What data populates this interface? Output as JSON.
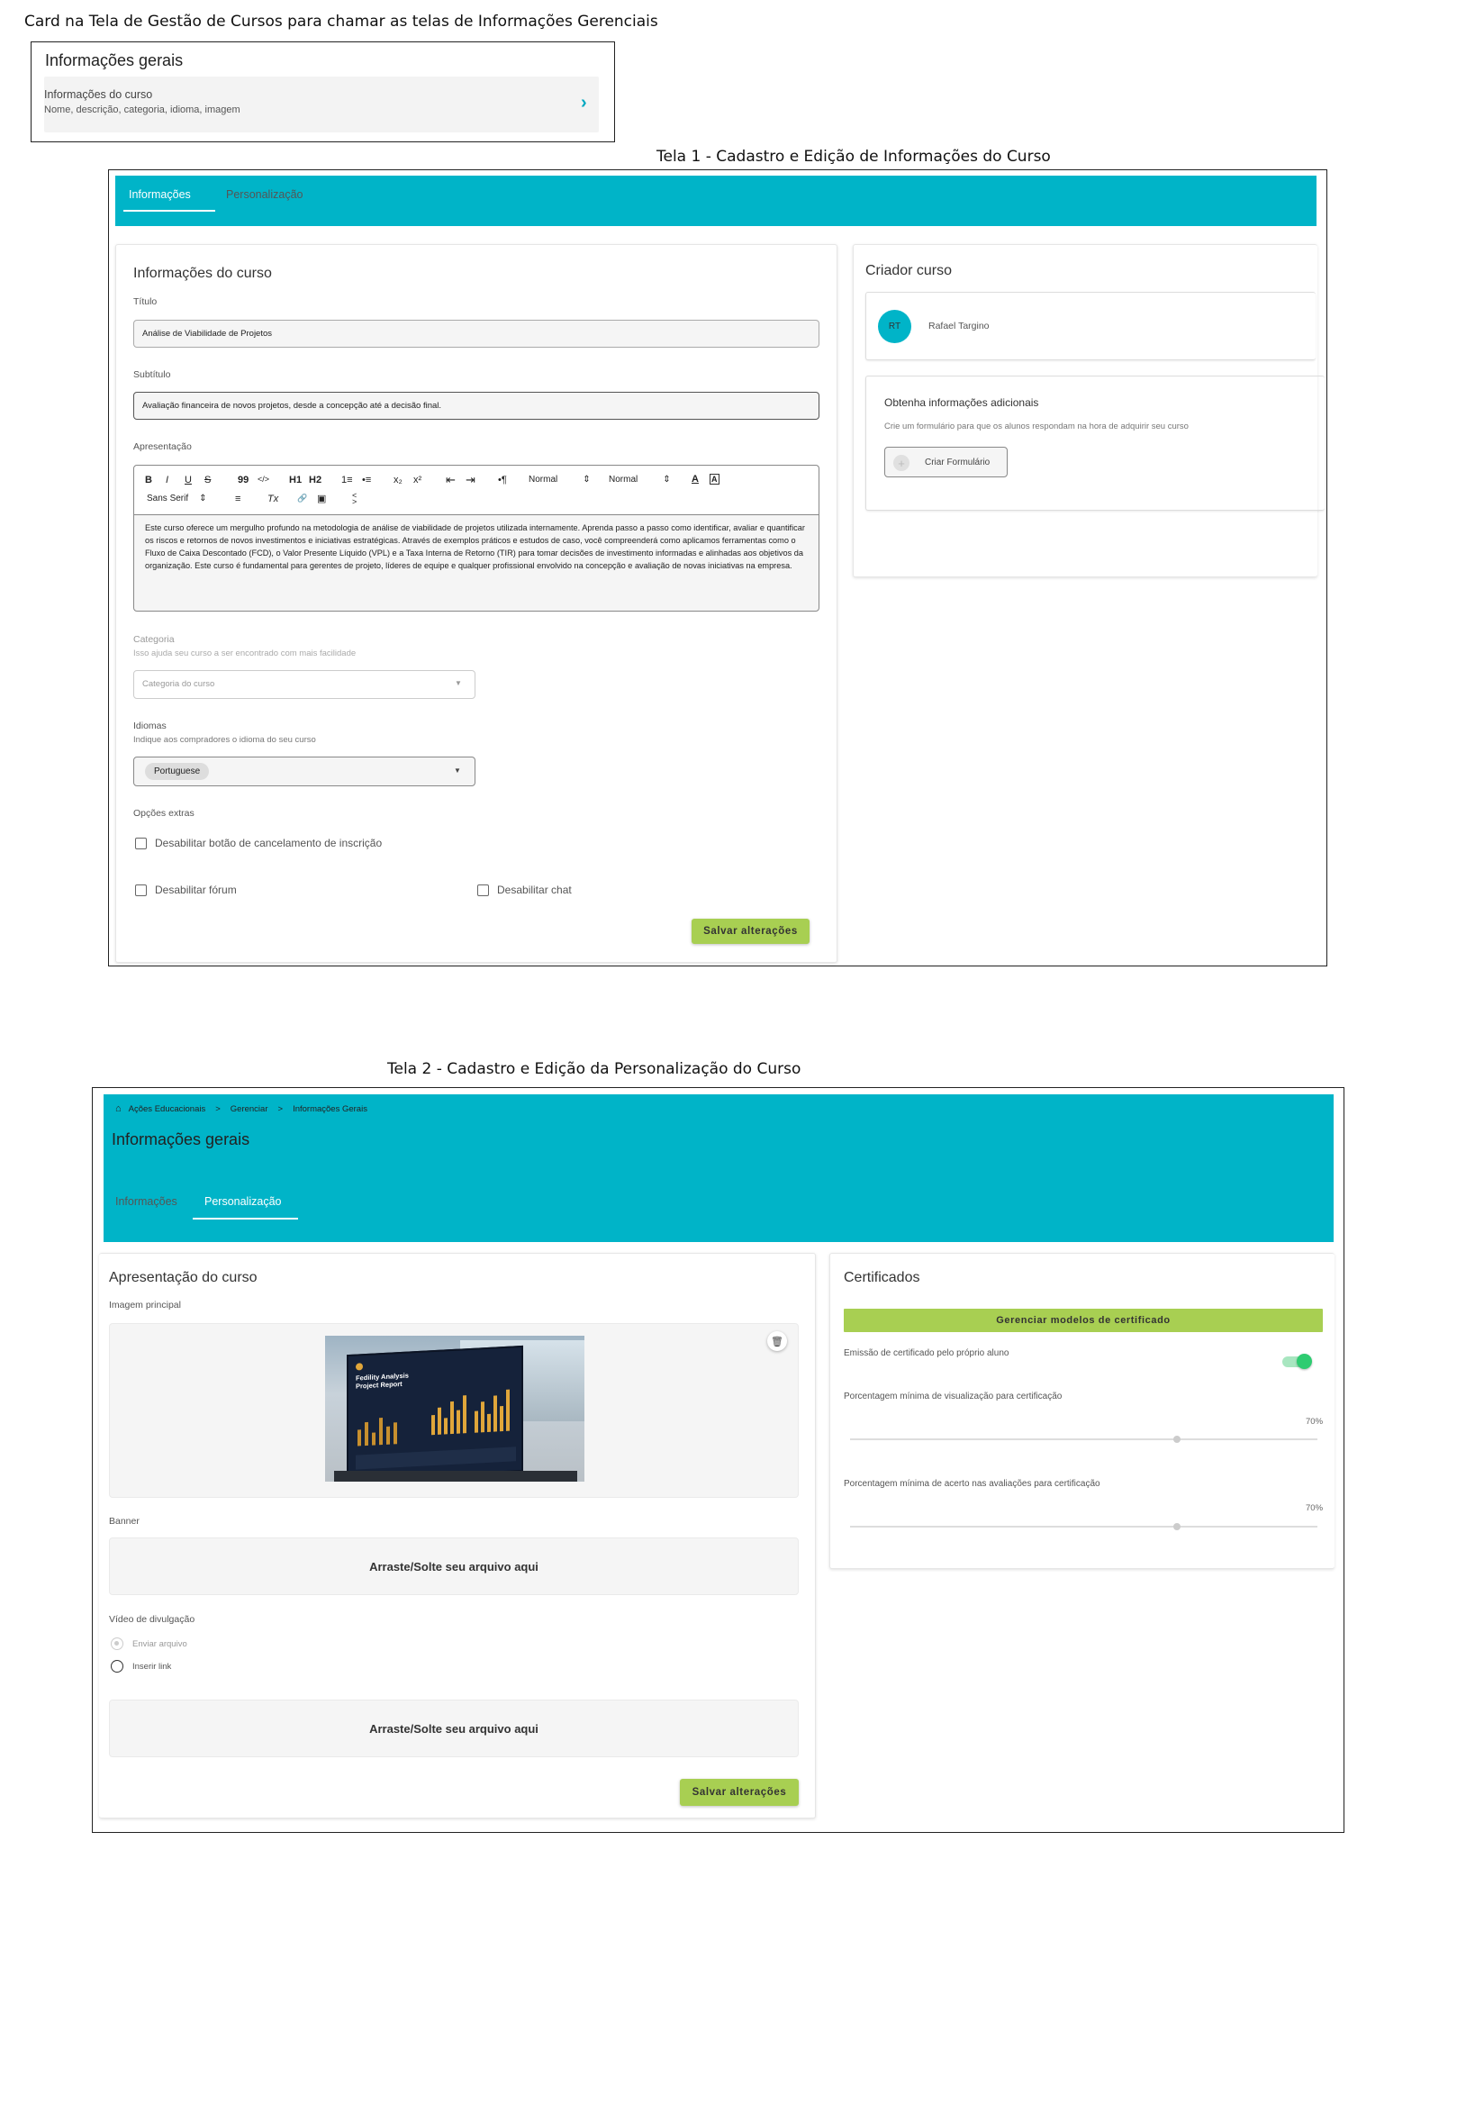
{
  "captions": {
    "card": "Card na Tela de Gestão de Cursos para chamar as telas de Informações Gerenciais",
    "tela1": "Tela 1 - Cadastro e Edição de Informações do Curso",
    "tela2": "Tela 2 - Cadastro e Edição da Personalização do Curso"
  },
  "card": {
    "title": "Informações gerais",
    "item_title": "Informações do curso",
    "item_desc": "Nome, descrição, categoria, idioma, imagem"
  },
  "tela1": {
    "tabs": [
      "Informações",
      "Personalização"
    ],
    "course_panel": {
      "title": "Informações do curso",
      "title_label": "Título",
      "title_value": "Análise de Viabilidade de Projetos",
      "subtitle_label": "Subtítulo",
      "subtitle_value": "Avaliação financeira de novos projetos, desde a concepção até a decisão final.",
      "presentation_label": "Apresentação",
      "toolbar": {
        "bold": "B",
        "italic": "I",
        "underline": "U",
        "strike": "S",
        "quote": "99",
        "code": "</>",
        "h1": "H1",
        "h2": "H2",
        "ol": "1≡",
        "ul": "•≡",
        "sub": "x₂",
        "sup": "x²",
        "outdent": "⇤",
        "indent": "⇥",
        "rtl": "•¶",
        "size1": "Normal",
        "size2": "Normal",
        "color": "A",
        "bg": "A",
        "font": "Sans Serif",
        "align": "≡",
        "clean": "Tx",
        "link": "🔗",
        "image": "▣",
        "video": "<>"
      },
      "presentation_text": "Este curso oferece um mergulho profundo na metodologia de análise de viabilidade de projetos utilizada internamente. Aprenda passo a passo como identificar, avaliar e quantificar os riscos e retornos de novos investimentos e iniciativas estratégicas. Através de exemplos práticos e estudos de caso, você compreenderá como aplicamos ferramentas como o Fluxo de Caixa Descontado (FCD), o Valor Presente Líquido (VPL) e a Taxa Interna de Retorno (TIR) para tomar decisões de investimento informadas e alinhadas aos objetivos da organização. Este curso é fundamental para gerentes de projeto, líderes de equipe e qualquer profissional envolvido na concepção e avaliação de novas iniciativas na empresa.",
      "category_label": "Categoria",
      "category_help": "Isso ajuda seu curso a ser encontrado com mais facilidade",
      "category_placeholder": "Categoria do curso",
      "languages_label": "Idiomas",
      "languages_help": "Indique aos compradores o idioma do seu curso",
      "language_chip": "Portuguese",
      "extras_label": "Opções extras",
      "opt_cancel": "Desabilitar botão de cancelamento de inscrição",
      "opt_forum": "Desabilitar fórum",
      "opt_chat": "Desabilitar chat",
      "save": "Salvar alterações"
    },
    "creator_panel": {
      "title": "Criador curso",
      "initials": "RT",
      "name": "Rafael Targino",
      "extra_title": "Obtenha informações adicionais",
      "extra_desc": "Crie um formulário para que os alunos respondam na hora de adquirir seu curso",
      "form_button": "Criar Formulário"
    }
  },
  "tela2": {
    "breadcrumb": [
      "Ações Educacionais",
      "Gerenciar",
      "Informações Gerais"
    ],
    "breadcrumb_sep": ">",
    "page_title": "Informações gerais",
    "tabs": [
      "Informações",
      "Personalização"
    ],
    "presentation_panel": {
      "title": "Apresentação do curso",
      "main_image_label": "Imagem principal",
      "image_heading": "Fedility Analysis Project Report",
      "banner_label": "Banner",
      "dropzone_text": "Arraste/Solte seu arquivo aqui",
      "video_label": "Vídeo de divulgação",
      "radio_upload": "Enviar arquivo",
      "radio_link": "Inserir link",
      "dropzone2_text": "Arraste/Solte seu arquivo aqui",
      "save": "Salvar alterações"
    },
    "certificates_panel": {
      "title": "Certificados",
      "manage_button": "Gerenciar modelos de certificado",
      "self_issue_label": "Emissão de certificado pelo próprio aluno",
      "self_issue_enabled": true,
      "view_pct_label": "Porcentagem mínima de visualização para certificação",
      "view_pct_value": "70%",
      "view_pct": 0.7,
      "score_pct_label": "Porcentagem mínima de acerto nas avaliações para certificação",
      "score_pct_value": "70%",
      "score_pct": 0.7
    }
  },
  "colors": {
    "header": "#00b4c8",
    "accent_green": "#a8cf52",
    "toggle": "#2ecc71"
  }
}
